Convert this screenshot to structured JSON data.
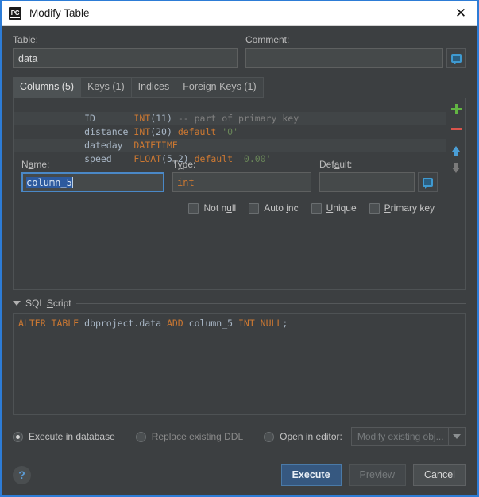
{
  "window": {
    "title": "Modify Table",
    "app_icon": "PC",
    "close_icon": "close-icon"
  },
  "form": {
    "table_label": "Table:",
    "table_label_mnemonic": "b",
    "table_value": "data",
    "comment_label": "Comment:",
    "comment_label_mnemonic": "C",
    "comment_value": "",
    "comment_button_icon": "comment-bubble-icon"
  },
  "tabs": [
    {
      "label": "Columns (5)",
      "active": true
    },
    {
      "label": "Keys (1)",
      "active": false
    },
    {
      "label": "Indices",
      "active": false
    },
    {
      "label": "Foreign Keys (1)",
      "active": false
    }
  ],
  "columns": [
    {
      "name": "ID",
      "pad": "       ",
      "type": "INT",
      "args": "(11)",
      "extra_kw": "",
      "extra_val": "",
      "comment": " -- part of primary key"
    },
    {
      "name": "distance",
      "pad": " ",
      "type": "INT",
      "args": "(20)",
      "extra_kw": " default",
      "extra_val": " '0'",
      "comment": ""
    },
    {
      "name": "dateday",
      "pad": "  ",
      "type": "DATETIME",
      "args": "",
      "extra_kw": "",
      "extra_val": "",
      "comment": ""
    },
    {
      "name": "speed",
      "pad": "    ",
      "type": "FLOAT",
      "args": "(5,2)",
      "extra_kw": " default",
      "extra_val": " '0.00'",
      "comment": ""
    }
  ],
  "list_toolbar": [
    {
      "icon": "add-icon",
      "color": "#62b543"
    },
    {
      "icon": "remove-icon",
      "color": "#d9544c"
    },
    {
      "icon": "move-up-icon",
      "color": "#4a9ed6"
    },
    {
      "icon": "move-down-icon",
      "color": "#7a7a7a"
    }
  ],
  "editor": {
    "name_label": "Name:",
    "name_label_mnemonic": "a",
    "name_value": "column_5",
    "type_label": "Type:",
    "type_label_mnemonic": "y",
    "type_value": "int",
    "default_label": "Default:",
    "default_label_mnemonic": "a",
    "default_value": "",
    "default_button_icon": "comment-bubble-icon",
    "checkboxes": [
      {
        "label_pre": "Not n",
        "label_mn": "u",
        "label_post": "ll",
        "checked": false,
        "name": "not-null"
      },
      {
        "label_pre": "Auto ",
        "label_mn": "i",
        "label_post": "nc",
        "checked": false,
        "name": "auto-inc"
      },
      {
        "label_pre": "",
        "label_mn": "U",
        "label_post": "nique",
        "checked": false,
        "name": "unique"
      },
      {
        "label_pre": "",
        "label_mn": "P",
        "label_post": "rimary key",
        "checked": false,
        "name": "primary-key"
      }
    ]
  },
  "sql_section": {
    "title_pre": "SQL ",
    "title_mn": "S",
    "title_post": "cript",
    "expanded": true,
    "code_tokens": [
      {
        "t": "ALTER TABLE",
        "c": "kw"
      },
      {
        "t": " dbproject.data",
        "c": "plain"
      },
      {
        "t": " ADD",
        "c": "kw"
      },
      {
        "t": " column_5",
        "c": "plain"
      },
      {
        "t": " INT NULL",
        "c": "kw"
      },
      {
        "t": ";",
        "c": "plain"
      }
    ],
    "code_text": "ALTER TABLE dbproject.data ADD column_5 INT NULL;"
  },
  "output_options": {
    "radios": [
      {
        "label": "Execute in database",
        "selected": true,
        "disabled": false,
        "name": "execute-in-database"
      },
      {
        "label": "Replace existing DDL",
        "selected": false,
        "disabled": true,
        "name": "replace-existing-ddl"
      },
      {
        "label": "Open in editor:",
        "selected": false,
        "disabled": false,
        "name": "open-in-editor"
      }
    ],
    "editor_target": "Modify existing obj...",
    "editor_target_disabled": true
  },
  "footer": {
    "help_label": "?",
    "buttons": [
      {
        "label": "Execute",
        "style": "default",
        "name": "execute-button"
      },
      {
        "label": "Preview",
        "style": "disabled",
        "name": "preview-button"
      },
      {
        "label": "Cancel",
        "style": "normal",
        "name": "cancel-button"
      }
    ]
  },
  "colors": {
    "accent_blue": "#2d7cd6",
    "default_button": "#365880",
    "keyword_orange": "#cc7832",
    "string_green": "#6a8759",
    "number_blue": "#6897bb",
    "comment_gray": "#808080",
    "add_green": "#62b543",
    "remove_red": "#d9544c",
    "panel_bg": "#3c3f41"
  }
}
